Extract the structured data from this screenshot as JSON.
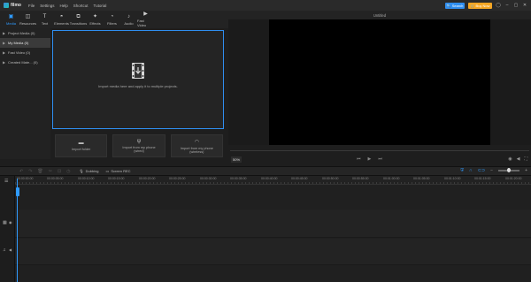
{
  "app": {
    "name": "filmo",
    "title": "Untitled"
  },
  "menu": [
    "File",
    "Settings",
    "Help",
    "Shortcut",
    "Tutorial"
  ],
  "title_actions": {
    "search": "Search",
    "buy": "Buy Now"
  },
  "tabs": [
    {
      "label": "Media",
      "icon": "media-icon",
      "active": true
    },
    {
      "label": "Resources",
      "icon": "resources-icon"
    },
    {
      "label": "Text",
      "icon": "text-icon"
    },
    {
      "label": "Elements",
      "icon": "elements-icon"
    },
    {
      "label": "Transitions",
      "icon": "transitions-icon"
    },
    {
      "label": "Effects",
      "icon": "effects-icon"
    },
    {
      "label": "Filters",
      "icon": "filters-icon"
    },
    {
      "label": "Audio",
      "icon": "audio-icon"
    },
    {
      "label": "Fast Video",
      "icon": "fast-video-icon"
    }
  ],
  "tree": [
    {
      "label": "Project Media (0)"
    },
    {
      "label": "My Media (0)",
      "selected": true
    },
    {
      "label": "Fast Video (0)"
    },
    {
      "label": "Created Mate... (0)"
    }
  ],
  "import": {
    "hint": "Import media here and apply it to multiple projects.",
    "buttons": [
      {
        "label": "Import folder",
        "icon": "folder-icon"
      },
      {
        "label": "Import from my phone\n(wired)",
        "icon": "usb-icon"
      },
      {
        "label": "Import from my phone\n(wireless)",
        "icon": "wifi-icon"
      }
    ]
  },
  "preview": {
    "zoom": "50%"
  },
  "edit_bar": {
    "dubbing": "Dubbing",
    "screen_rec": "Screen REC"
  },
  "ruler": [
    "00:00:00:00",
    "00:00:05:00",
    "00:00:10:00",
    "00:00:15:00",
    "00:00:20:00",
    "00:00:25:00",
    "00:00:30:00",
    "00:00:35:00",
    "00:00:40:00",
    "00:00:45:00",
    "00:00:50:00",
    "00:00:55:00",
    "00:01:00:00",
    "00:01:05:00",
    "00:01:10:00",
    "00:01:15:00",
    "00:01:20:00"
  ],
  "colors": {
    "accent": "#2f8ef0",
    "buy": "#f5a623"
  }
}
